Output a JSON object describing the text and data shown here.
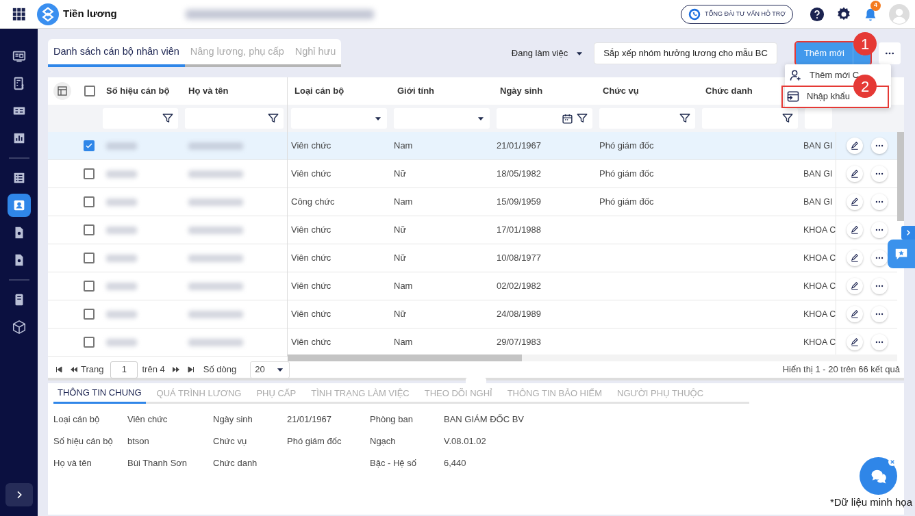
{
  "header": {
    "app_title": "Tiền lương",
    "support_label": "TỔNG ĐÀI TƯ VẤN HỖ TRỢ",
    "notification_count": "4"
  },
  "sidebar": {
    "items": [
      {
        "kind": "dashboard",
        "selected": false
      },
      {
        "kind": "calculator",
        "selected": false
      },
      {
        "kind": "payment",
        "selected": false
      },
      {
        "kind": "chart",
        "selected": false
      },
      {
        "kind": "list",
        "selected": false
      },
      {
        "kind": "person",
        "selected": true
      },
      {
        "kind": "file-gear",
        "selected": false
      },
      {
        "kind": "file-gear",
        "selected": false
      },
      {
        "kind": "ledger",
        "selected": false
      },
      {
        "kind": "cube",
        "selected": false
      }
    ]
  },
  "tabs": [
    {
      "label": "Danh sách cán bộ nhân viên",
      "selected": true
    },
    {
      "label": "Nâng lương, phụ cấp",
      "selected": false
    },
    {
      "label": "Nghỉ hưu",
      "selected": false
    }
  ],
  "status_filter": "Đang làm việc",
  "sort_button": "Sắp xếp nhóm hưởng lương cho mẫu BC",
  "add_button": {
    "label": "Thêm mới",
    "highlighted": true,
    "marker": "1"
  },
  "add_menu": [
    {
      "kind": "add-person",
      "label": "Thêm mới C",
      "highlighted": false
    },
    {
      "kind": "import",
      "label": "Nhập khẩu",
      "highlighted": true,
      "marker": "2"
    }
  ],
  "table": {
    "select_all_checked": false,
    "columns": [
      {
        "label": "Số hiệu cán bộ",
        "kind": "text"
      },
      {
        "label": "Họ và tên",
        "kind": "text"
      },
      {
        "label": "Loại cán bộ",
        "kind": "select"
      },
      {
        "label": "Giới tính",
        "kind": "select"
      },
      {
        "label": "Ngày sinh",
        "kind": "date"
      },
      {
        "label": "Chức vụ",
        "kind": "text"
      },
      {
        "label": "Chức danh",
        "kind": "text"
      },
      {
        "kind": "none"
      }
    ],
    "rows": [
      {
        "selected": true,
        "cells": [
          "",
          "",
          "Viên chức",
          "Nam",
          "21/01/1967",
          "Phó giám đốc",
          "",
          "BAN GI"
        ]
      },
      {
        "selected": false,
        "cells": [
          "",
          "",
          "Viên chức",
          "Nữ",
          "18/05/1982",
          "Phó giám đốc",
          "",
          "BAN GI"
        ]
      },
      {
        "selected": false,
        "cells": [
          "",
          "",
          "Công chức",
          "Nam",
          "15/09/1959",
          "Phó giám đốc",
          "",
          "BAN GI"
        ]
      },
      {
        "selected": false,
        "cells": [
          "",
          "",
          "Viên chức",
          "Nữ",
          "17/01/1988",
          "",
          "",
          "KHOA C"
        ]
      },
      {
        "selected": false,
        "cells": [
          "",
          "",
          "Viên chức",
          "Nữ",
          "10/08/1977",
          "",
          "",
          "KHOA C"
        ]
      },
      {
        "selected": false,
        "cells": [
          "",
          "",
          "Viên chức",
          "Nam",
          "02/02/1982",
          "",
          "",
          "KHOA C"
        ]
      },
      {
        "selected": false,
        "cells": [
          "",
          "",
          "Viên chức",
          "Nữ",
          "24/08/1989",
          "",
          "",
          "KHOA C"
        ]
      },
      {
        "selected": false,
        "cells": [
          "",
          "",
          "Viên chức",
          "Nam",
          "29/07/1983",
          "",
          "",
          "KHOA C"
        ]
      }
    ]
  },
  "pager": {
    "page_label": "Trang",
    "page": "1",
    "of": "trên 4",
    "rows_label": "Số dòng",
    "rows": "20",
    "summary": "Hiển thị 1 - 20 trên 66 kết quả"
  },
  "detail_tabs": [
    {
      "label": "THÔNG TIN CHUNG",
      "selected": true
    },
    {
      "label": "QUÁ TRÌNH LƯƠNG",
      "selected": false
    },
    {
      "label": "PHỤ CẤP",
      "selected": false
    },
    {
      "label": "TÌNH TRẠNG LÀM VIỆC",
      "selected": false
    },
    {
      "label": "THEO DÕI NGHỈ",
      "selected": false
    },
    {
      "label": "THÔNG TIN BẢO HIỂM",
      "selected": false
    },
    {
      "label": "NGƯỜI PHỤ THUỘC",
      "selected": false
    }
  ],
  "detail_fields": [
    [
      {
        "label": "Loại cán bộ",
        "value": "Viên chức"
      },
      {
        "label": "Số hiệu cán bộ",
        "value": "btson"
      },
      {
        "label": "Họ và tên",
        "value": "Bùi Thanh Sơn"
      }
    ],
    [
      {
        "label": "Ngày sinh",
        "value": "21/01/1967"
      },
      {
        "label": "Chức vụ",
        "value": "Phó giám đốc"
      },
      {
        "label": "Chức danh"
      }
    ],
    [
      {
        "label": "Phòng ban",
        "value": "BAN GIÁM ĐỐC BV"
      },
      {
        "label": "Ngạch",
        "value": "V.08.01.02"
      },
      {
        "label": "Bậc - Hệ số",
        "value": "6,440"
      }
    ]
  ],
  "footnote": "*Dữ liệu minh họa"
}
